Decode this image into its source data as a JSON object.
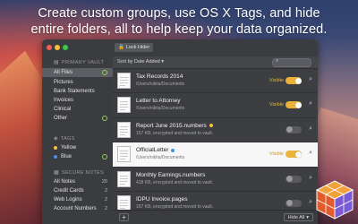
{
  "headline": {
    "line1": "Create custom groups, use OS X Tags, and hide",
    "line2": "entire folders, all to help keep your data organized."
  },
  "toolbar": {
    "lock_label": "Lock Hider"
  },
  "sortbar": {
    "sort_label": "Sort by Date Added ▾"
  },
  "sidebar": {
    "primary_header": "PRIMARY VAULT",
    "tags_header": "TAGS",
    "secure_header": "SECURE NOTES",
    "primary_items": [
      {
        "label": "All Files"
      },
      {
        "label": "Pictures"
      },
      {
        "label": "Bank Statements"
      },
      {
        "label": "Invoices"
      },
      {
        "label": "Clinical"
      },
      {
        "label": "Other"
      }
    ],
    "tag_items": [
      {
        "label": "Yellow",
        "color": "#f5c33b"
      },
      {
        "label": "Blue",
        "color": "#4a8fe0"
      }
    ],
    "secure_items": [
      {
        "label": "All Notes",
        "count": "20"
      },
      {
        "label": "Credit Cards",
        "count": "2"
      },
      {
        "label": "Web Logins",
        "count": "2"
      },
      {
        "label": "Account Numbers",
        "count": "2"
      }
    ]
  },
  "files": [
    {
      "name": "Tax Records 2014",
      "sub": "/Users/nikita/Documents",
      "visible_label": "Visible",
      "visible": true
    },
    {
      "name": "Letter to Attorney",
      "sub": "/Users/nikita/Documents",
      "visible_label": "Visible",
      "visible": true
    },
    {
      "name": "Report June 2015.numbers",
      "sub": "157 KB, encrypted and moved to vault.",
      "visible": false,
      "tag_color": "#f5c33b"
    },
    {
      "name": "OfficialLetter",
      "sub": "/Users/nikita/Documents",
      "visible_label": "Visible",
      "visible": true,
      "tag_color": "#4a8fe0"
    },
    {
      "name": "Monthly Earnings.numbers",
      "sub": "418 KB, encrypted and moved to vault.",
      "visible": false
    },
    {
      "name": "IDPU Invoice.pages",
      "sub": "157 KB, encrypted and moved to vault.",
      "visible": false
    }
  ],
  "bottombar": {
    "add_label": "+",
    "hideall_label": "Hide All"
  },
  "colors": {
    "accent": "#ecb33a",
    "sidebar_bg": "#3b3c40",
    "main_bg": "#3d3e42",
    "highlight_row": "#f7f7f7"
  }
}
